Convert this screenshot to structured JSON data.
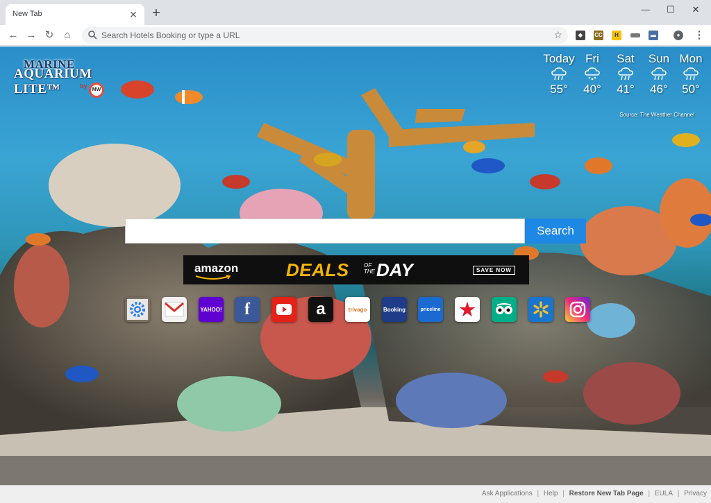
{
  "browser": {
    "tab_title": "New Tab",
    "omnibox_placeholder": "Search Hotels Booking or type a URL"
  },
  "logo": {
    "line1": "MARINE",
    "line2": "AQUARIUM LITE™",
    "by": "by",
    "badge": "MW"
  },
  "weather": {
    "days": [
      {
        "name": "Today",
        "temp": "55°",
        "icon": "rain-cloud-icon"
      },
      {
        "name": "Fri",
        "temp": "40°",
        "icon": "snow-cloud-icon"
      },
      {
        "name": "Sat",
        "temp": "41°",
        "icon": "rain-cloud-icon"
      },
      {
        "name": "Sun",
        "temp": "46°",
        "icon": "rain-cloud-icon"
      },
      {
        "name": "Mon",
        "temp": "50°",
        "icon": "rain-cloud-icon"
      }
    ],
    "source": "Source: The Weather Channel"
  },
  "search": {
    "button_label": "Search",
    "value": ""
  },
  "banner": {
    "brand": "amazon",
    "deals": "DEALS",
    "of": "OF THE",
    "day": "DAY",
    "cta": "SAVE NOW"
  },
  "shortcuts": [
    {
      "name": "settings",
      "label": "",
      "icon": "gear-icon",
      "bg": "#e8e8e8",
      "fg": "#2f80ed"
    },
    {
      "name": "gmail",
      "label": "",
      "icon": "gmail-icon",
      "bg": "#f2f2f2",
      "fg": "#d93025"
    },
    {
      "name": "yahoo",
      "label": "YAHOO!",
      "icon": "yahoo-icon",
      "bg": "#5f01d1",
      "fg": "#ffffff"
    },
    {
      "name": "facebook",
      "label": "f",
      "icon": "facebook-icon",
      "bg": "#3b5998",
      "fg": "#ffffff"
    },
    {
      "name": "youtube",
      "label": "",
      "icon": "youtube-icon",
      "bg": "#e62117",
      "fg": "#ffffff"
    },
    {
      "name": "amazon",
      "label": "a",
      "icon": "amazon-icon",
      "bg": "#111111",
      "fg": "#ffffff"
    },
    {
      "name": "trivago",
      "label": "trivago",
      "icon": "trivago-icon",
      "bg": "#ffffff",
      "fg": "#e37222"
    },
    {
      "name": "booking",
      "label": "Booking",
      "icon": "booking-icon",
      "bg": "#1f3c88",
      "fg": "#ffffff"
    },
    {
      "name": "priceline",
      "label": "priceline",
      "icon": "priceline-icon",
      "bg": "#1b6ad1",
      "fg": "#ffffff"
    },
    {
      "name": "macys",
      "label": "★",
      "icon": "macys-star-icon",
      "bg": "#ffffff",
      "fg": "#e11a2b"
    },
    {
      "name": "tripadvisor",
      "label": "",
      "icon": "tripadvisor-icon",
      "bg": "#00af87",
      "fg": "#ffffff"
    },
    {
      "name": "walmart",
      "label": "",
      "icon": "walmart-icon",
      "bg": "#1a75cf",
      "fg": "#ffc220"
    },
    {
      "name": "instagram",
      "label": "",
      "icon": "instagram-icon",
      "bg": "#c13584",
      "fg": "#ffffff"
    }
  ],
  "footer": {
    "ask_applications": "Ask Applications",
    "help": "Help",
    "restore": "Restore New Tab Page",
    "eula": "EULA",
    "privacy": "Privacy",
    "sep": "|"
  }
}
